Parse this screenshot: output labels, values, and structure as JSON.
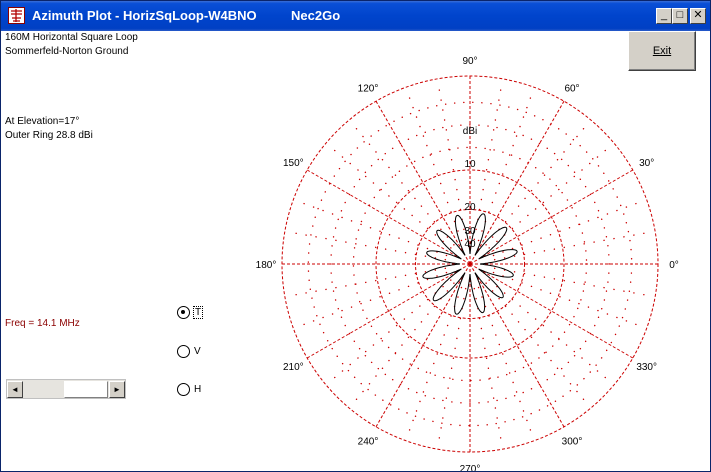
{
  "window": {
    "title": "Azimuth Plot - HorizSqLoop-W4BNO",
    "title_extra": "Nec2Go",
    "min_label": "_",
    "max_label": "□",
    "close_label": "✕"
  },
  "info": {
    "line1": "160M Horizontal Square Loop",
    "line2": "Sommerfeld-Norton Ground",
    "elevation": "At Elevation=17°",
    "outer_ring": "Outer Ring 28.8 dBi",
    "freq": "Freq = 14.1 MHz"
  },
  "exit_label": "Exit",
  "radios": [
    {
      "label": "T",
      "checked": true
    },
    {
      "label": "V",
      "checked": false
    },
    {
      "label": "H",
      "checked": false
    }
  ],
  "scrollbar": {
    "left_arrow": "◄",
    "right_arrow": "►"
  },
  "polar": {
    "unit": "dBi",
    "ring_labels": [
      "10",
      "20",
      "30",
      "40"
    ],
    "angle_labels": [
      "0°",
      "30°",
      "60°",
      "90°",
      "120°",
      "150°",
      "180°",
      "210°",
      "240°",
      "270°",
      "300°",
      "330°"
    ],
    "grid_color": "#cc0000",
    "pattern_color": "#000000"
  },
  "colors": {
    "title_bar": "#0044cc",
    "freq_text": "#8b0000"
  }
}
